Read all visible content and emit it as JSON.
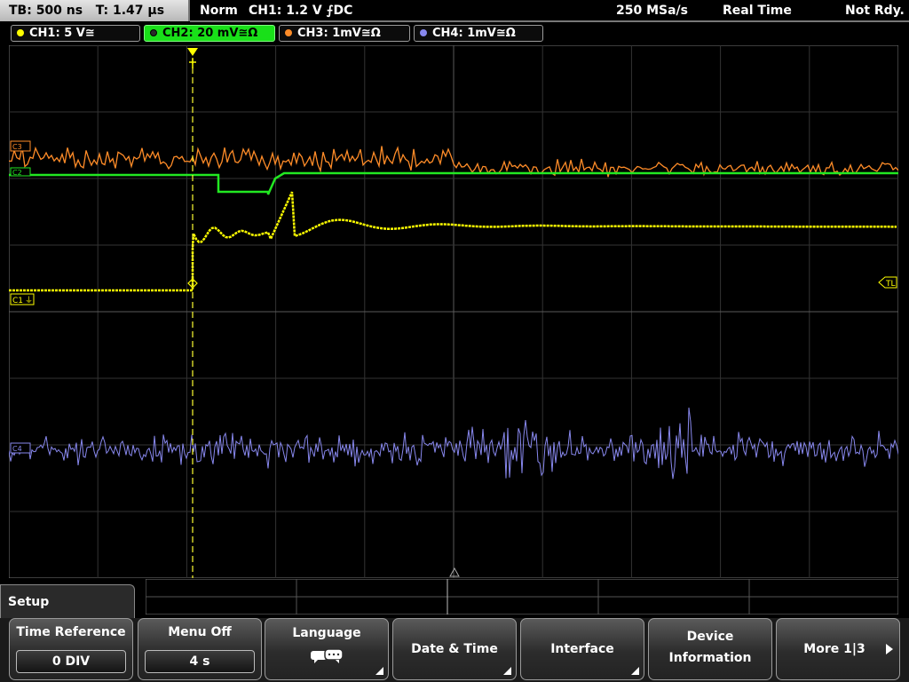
{
  "status_bar": {
    "timebase": "TB: 500 ns   T: 1.47 µs",
    "trigger_mode": "Norm",
    "trigger_setting": "CH1: 1.2 V ⨍DC",
    "sample_rate": "250 MSa/s",
    "acquisition": "Real Time",
    "state": "Not Rdy."
  },
  "channels": [
    {
      "label": "CH1: 5 V≅",
      "color": "#ffff00",
      "marker": "C1"
    },
    {
      "label": "CH2: 20 mV≅Ω",
      "color": "#22e822",
      "marker": "C2"
    },
    {
      "label": "CH3: 1mV≅Ω",
      "color": "#ff8c28",
      "marker": "C3"
    },
    {
      "label": "CH4: 1mV≅Ω",
      "color": "#8888ee",
      "marker": "C4"
    }
  ],
  "markers": {
    "trigger_level": "TL"
  },
  "menu": {
    "title": "Setup",
    "softkeys": [
      {
        "title": "Time Reference",
        "value": "0 DIV"
      },
      {
        "title": "Menu Off",
        "value": "4 s"
      },
      {
        "title": "Language",
        "icon": "speech-bubble-icon"
      },
      {
        "title": "Date & Time"
      },
      {
        "title": "Interface"
      },
      {
        "title": "Device",
        "subtitle": "Information"
      },
      {
        "title": "More 1|3"
      }
    ]
  }
}
